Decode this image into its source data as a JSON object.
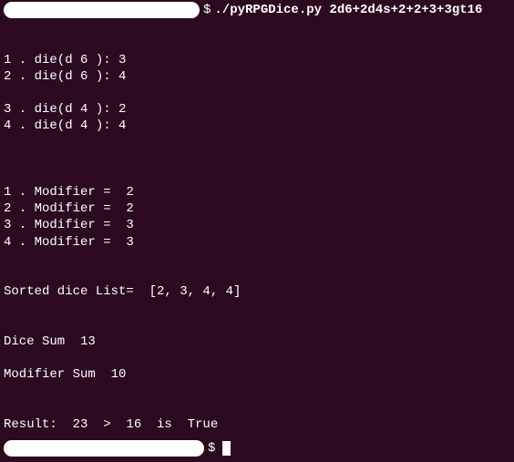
{
  "chart_data": {
    "type": "table",
    "program": "./pyRPGDice.py",
    "expression": "2d6+2d4s+2+2+3+3gt16",
    "dice": [
      {
        "n": 1,
        "sides": 6,
        "roll": 3
      },
      {
        "n": 2,
        "sides": 6,
        "roll": 4
      },
      {
        "n": 3,
        "sides": 4,
        "roll": 2
      },
      {
        "n": 4,
        "sides": 4,
        "roll": 4
      }
    ],
    "modifiers": [
      2,
      2,
      3,
      3
    ],
    "sorted_list": [
      2,
      3,
      4,
      4
    ],
    "dice_sum": 13,
    "modifier_sum": 10,
    "result_total": 23,
    "comparator": ">",
    "target": 16,
    "outcome": "True"
  },
  "prompt": {
    "dollar": "$",
    "command": "./pyRPGDice.py 2d6+2d4s+2+2+3+3gt16"
  },
  "output": {
    "d1": "1 . die(d 6 ): 3",
    "d2": "2 . die(d 6 ): 4",
    "d3": "3 . die(d 4 ): 2",
    "d4": "4 . die(d 4 ): 4",
    "m1": "1 . Modifier =  2",
    "m2": "2 . Modifier =  2",
    "m3": "3 . Modifier =  3",
    "m4": "4 . Modifier =  3",
    "sorted": "Sorted dice List=  [2, 3, 4, 4]",
    "dice_sum": "Dice Sum  13",
    "mod_sum": "Modifier Sum  10",
    "result": "Result:  23  >  16  is  True"
  }
}
